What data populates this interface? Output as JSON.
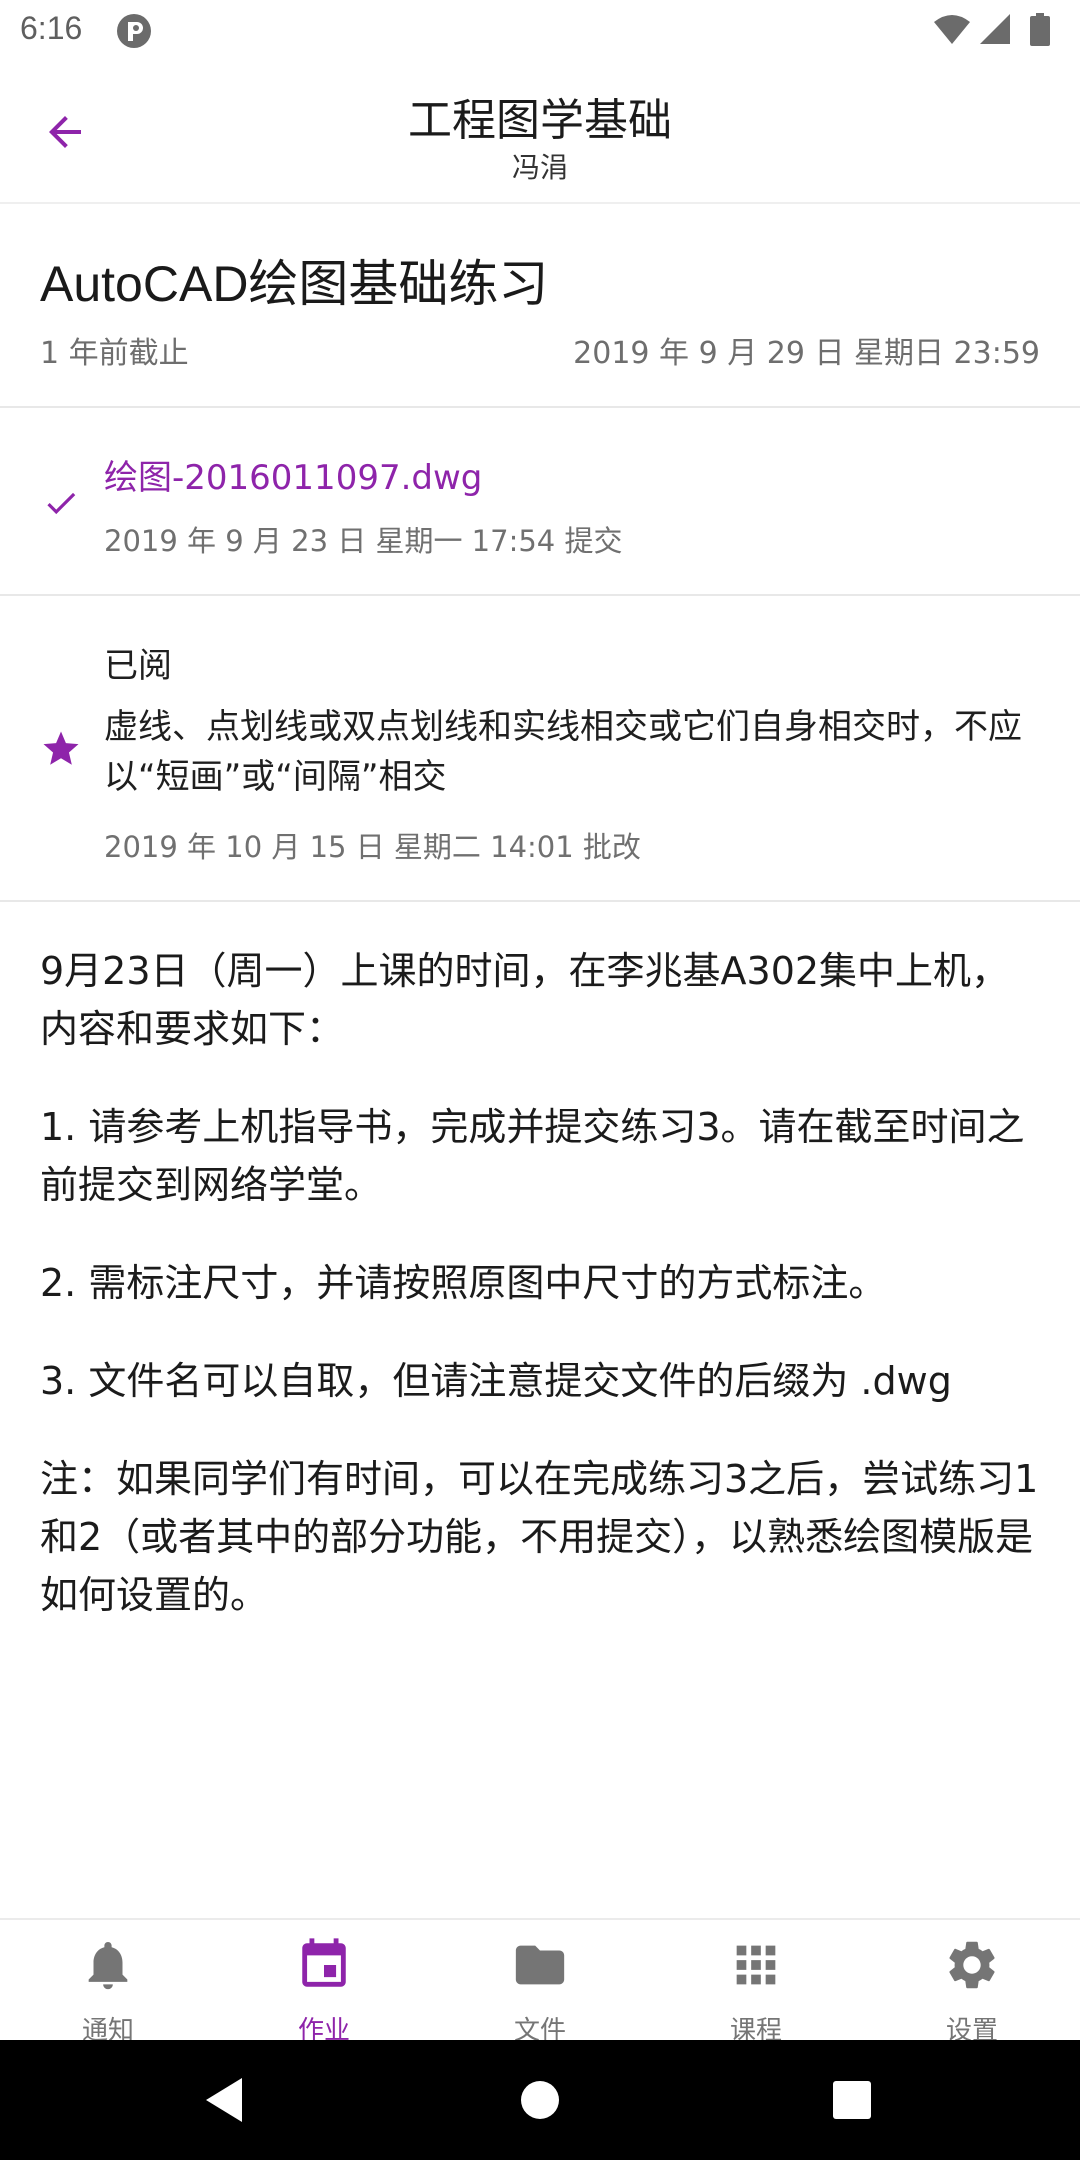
{
  "status_bar": {
    "time": "6:16",
    "icons": [
      "app-notification-icon",
      "wifi-icon",
      "signal-icon",
      "battery-icon"
    ]
  },
  "app_bar": {
    "title": "工程图学基础",
    "subtitle": "冯涓",
    "back_icon": "arrow-left-icon"
  },
  "assignment": {
    "title": "AutoCAD绘图基础练习",
    "deadline_relative": "1 年前截止",
    "deadline_absolute": "2019 年 9 月 29 日 星期日 23:59"
  },
  "submission": {
    "icon": "check-icon",
    "file_name": "绘图-2016011097.dwg",
    "submitted_at": "2019 年 9 月 23 日 星期一 17:54 提交"
  },
  "grade": {
    "icon": "star-icon",
    "status": "已阅",
    "comment": "虚线、点划线或双点划线和实线相交或它们自身相交时，不应以“短画”或“间隔”相交",
    "graded_at": "2019 年 10 月 15 日 星期二 14:01 批改"
  },
  "description": {
    "paragraphs": [
      "9月23日（周一）上课的时间，在李兆基A302集中上机，内容和要求如下：",
      "1. 请参考上机指导书，完成并提交练习3。请在截至时间之前提交到网络学堂。",
      "2. 需标注尺寸，并请按照原图中尺寸的方式标注。",
      "3. 文件名可以自取，但请注意提交文件的后缀为 .dwg",
      "注：如果同学们有时间，可以在完成练习3之后，尝试练习1和2（或者其中的部分功能，不用提交），以熟悉绘图模版是如何设置的。"
    ]
  },
  "bottom_nav": {
    "items": [
      {
        "label": "通知",
        "icon": "bell-icon",
        "active": false
      },
      {
        "label": "作业",
        "icon": "calendar-icon",
        "active": true
      },
      {
        "label": "文件",
        "icon": "folder-icon",
        "active": false
      },
      {
        "label": "课程",
        "icon": "grid-icon",
        "active": false
      },
      {
        "label": "设置",
        "icon": "gear-icon",
        "active": false
      }
    ]
  },
  "system_nav": {
    "buttons": [
      "back-triangle-icon",
      "home-circle-icon",
      "recents-square-icon"
    ]
  },
  "colors": {
    "accent": "#8e24aa",
    "inactive": "#757575",
    "divider": "#e8e8e8",
    "text": "#1f1f1f",
    "secondary_text": "#707070"
  }
}
